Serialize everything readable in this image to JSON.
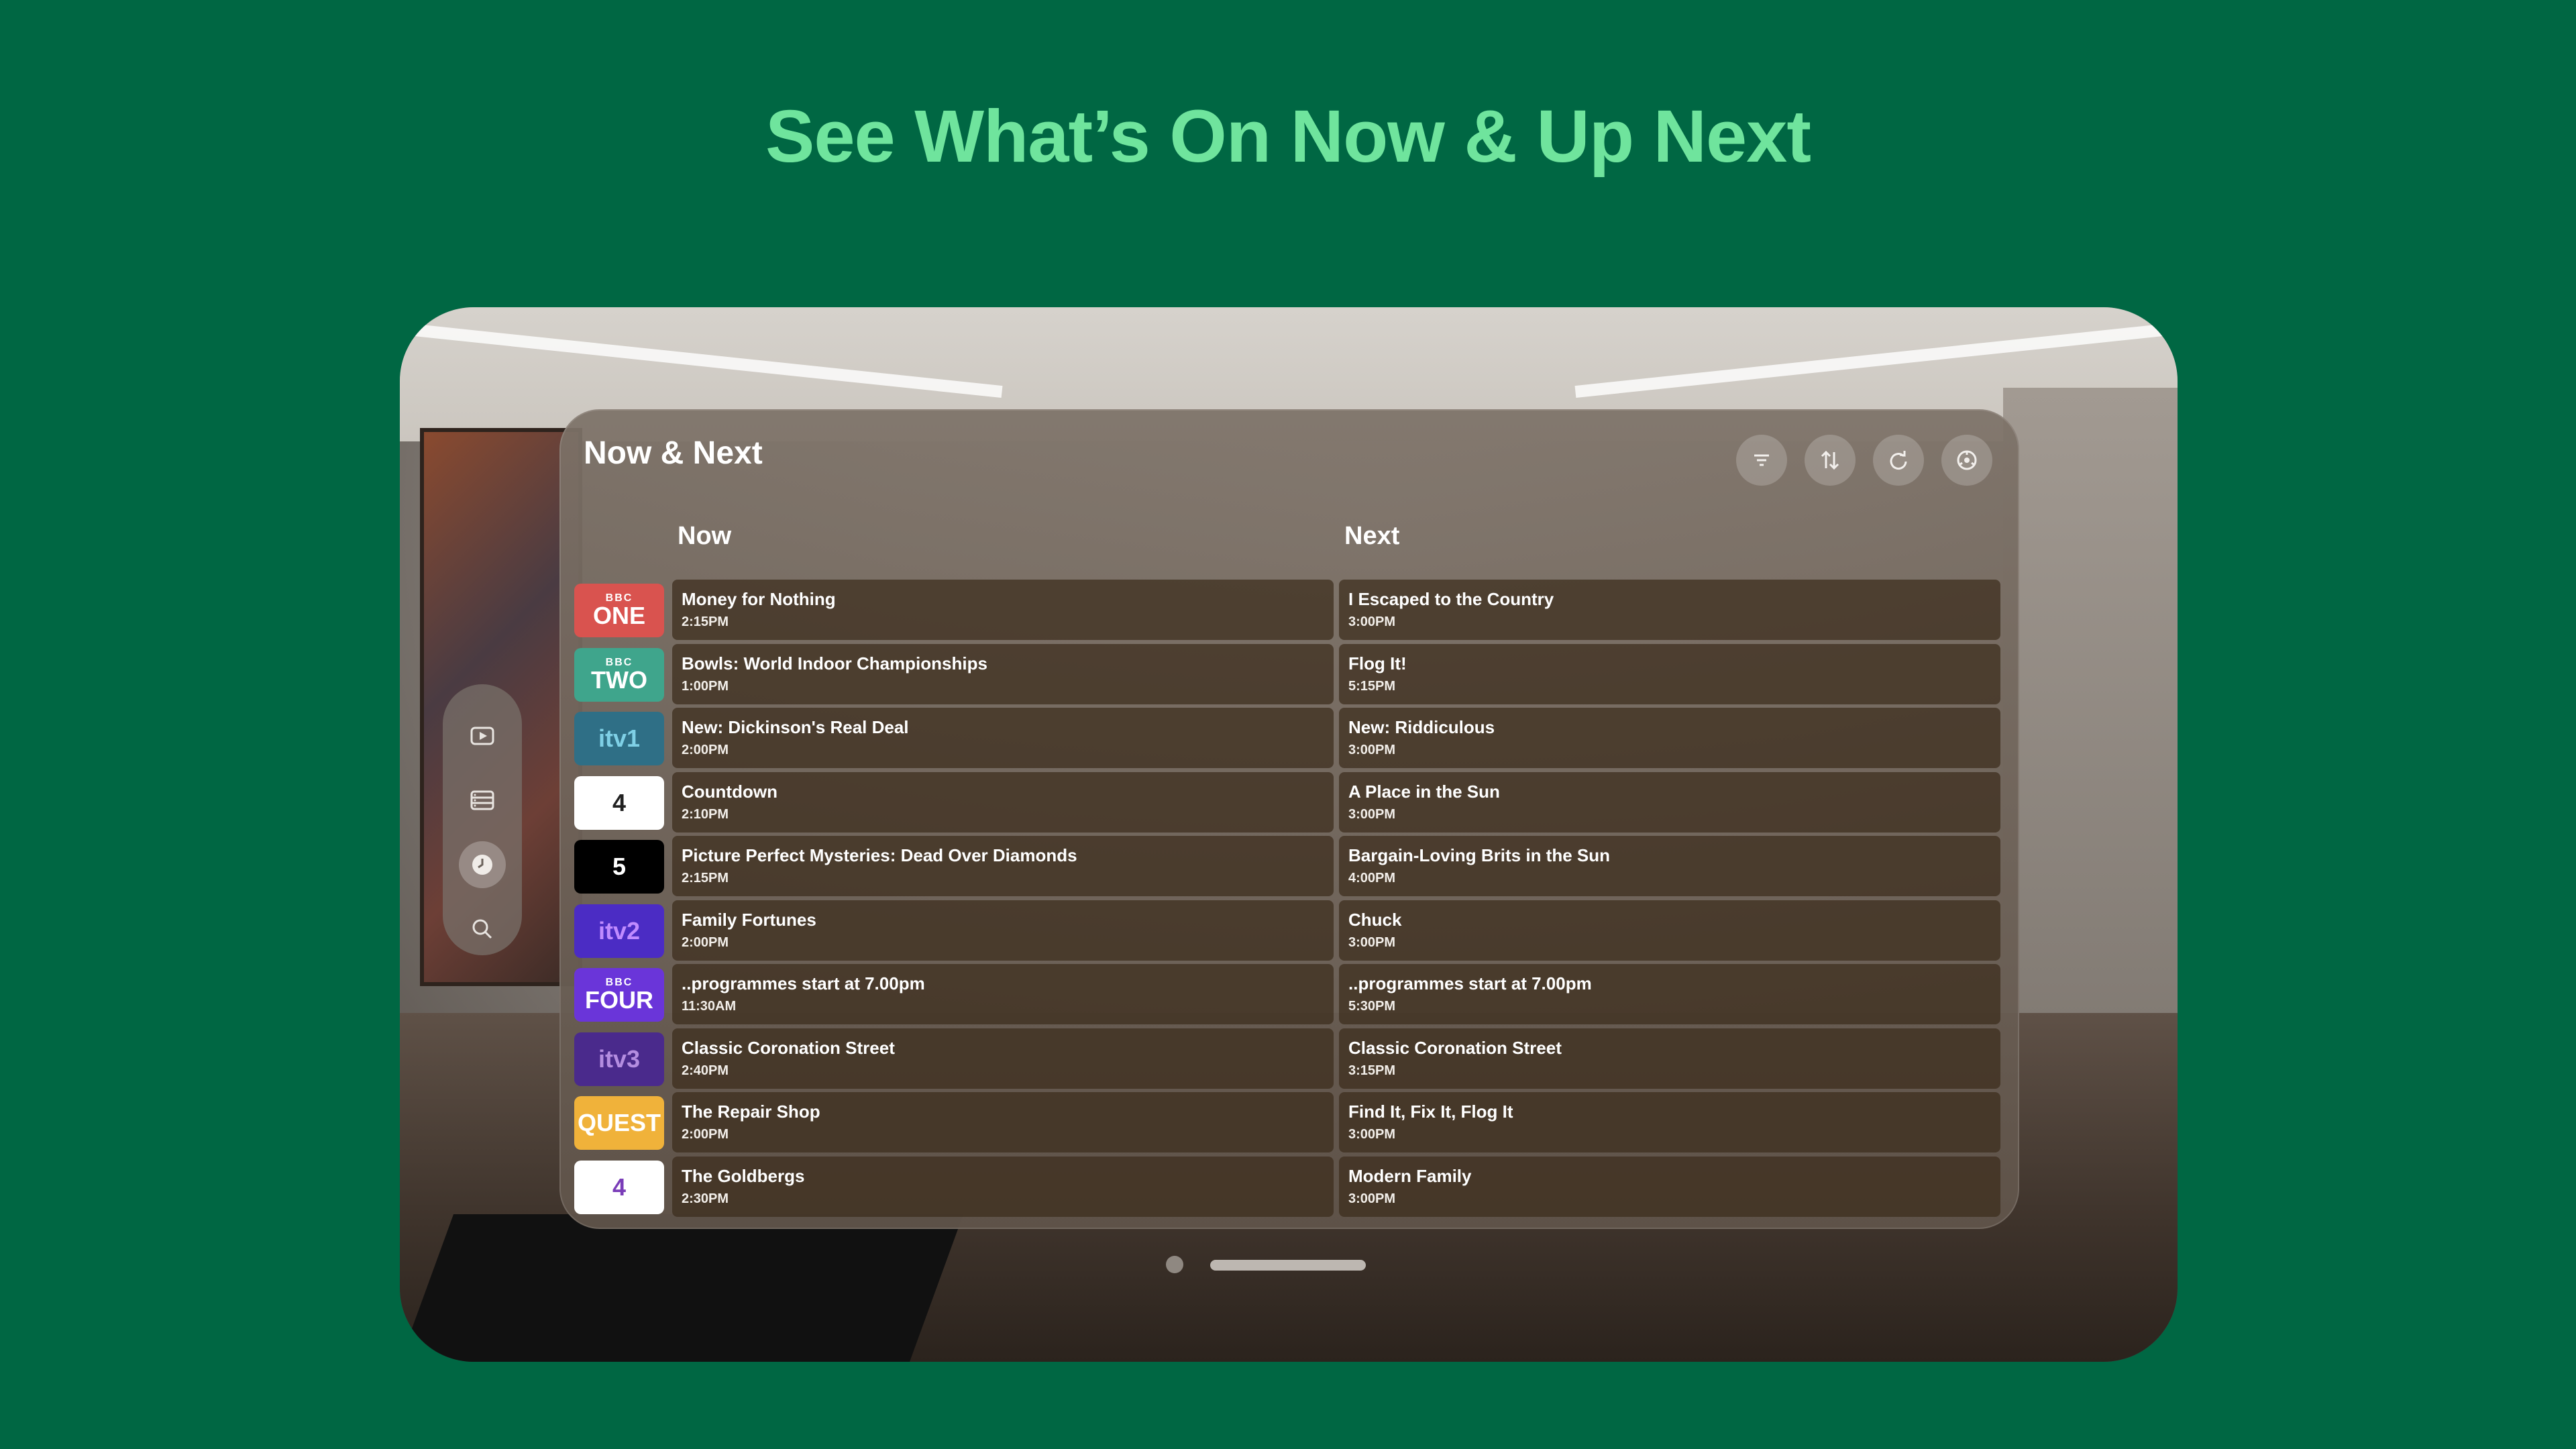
{
  "headline": "See What’s On Now & Up Next",
  "panel": {
    "title": "Now & Next",
    "col_now": "Now",
    "col_next": "Next",
    "toolbar": [
      {
        "name": "filter",
        "icon": "filter-icon"
      },
      {
        "name": "sort",
        "icon": "sort-arrows-icon"
      },
      {
        "name": "refresh",
        "icon": "refresh-icon"
      },
      {
        "name": "settings",
        "icon": "settings-icon"
      }
    ]
  },
  "sidebar": {
    "items": [
      {
        "name": "play",
        "icon": "play-icon",
        "active": false
      },
      {
        "name": "list",
        "icon": "list-icon",
        "active": false
      },
      {
        "name": "clock",
        "icon": "clock-icon",
        "active": true
      },
      {
        "name": "search",
        "icon": "search-icon",
        "active": false
      }
    ]
  },
  "channels": [
    {
      "logo": "ONE",
      "logo_top": "BBC",
      "bg": "#d9534f",
      "fg": "#ffffff",
      "now_title": "Money for Nothing",
      "now_time": "2:15PM",
      "next_title": "I Escaped to the Country",
      "next_time": "3:00PM"
    },
    {
      "logo": "TWO",
      "logo_top": "BBC",
      "bg": "#3fa58c",
      "fg": "#ffffff",
      "now_title": "Bowls: World Indoor Championships",
      "now_time": "1:00PM",
      "next_title": "Flog It!",
      "next_time": "5:15PM"
    },
    {
      "logo": "itv1",
      "logo_top": "",
      "bg": "#2f6f86",
      "fg": "#7fd0e6",
      "now_title": "New: Dickinson's Real Deal",
      "now_time": "2:00PM",
      "next_title": "New: Riddiculous",
      "next_time": "3:00PM"
    },
    {
      "logo": "4",
      "logo_top": "",
      "bg": "#ffffff",
      "fg": "#222222",
      "now_title": "Countdown",
      "now_time": "2:10PM",
      "next_title": "A Place in the Sun",
      "next_time": "3:00PM"
    },
    {
      "logo": "5",
      "logo_top": "",
      "bg": "#000000",
      "fg": "#ffffff",
      "now_title": "Picture Perfect Mysteries: Dead Over Diamonds",
      "now_time": "2:15PM",
      "next_title": "Bargain-Loving Brits in the Sun",
      "next_time": "4:00PM"
    },
    {
      "logo": "itv2",
      "logo_top": "",
      "bg": "#4b2cc4",
      "fg": "#c08bff",
      "now_title": "Family Fortunes",
      "now_time": "2:00PM",
      "next_title": "Chuck",
      "next_time": "3:00PM"
    },
    {
      "logo": "FOUR",
      "logo_top": "BBC",
      "bg": "#6a35d9",
      "fg": "#ffffff",
      "now_title": "..programmes start at 7.00pm",
      "now_time": "11:30AM",
      "next_title": "..programmes start at 7.00pm",
      "next_time": "5:30PM"
    },
    {
      "logo": "itv3",
      "logo_top": "",
      "bg": "#4a2a8c",
      "fg": "#b48de0",
      "now_title": "Classic Coronation Street",
      "now_time": "2:40PM",
      "next_title": "Classic Coronation Street",
      "next_time": "3:15PM"
    },
    {
      "logo": "QUEST",
      "logo_top": "",
      "bg": "#f0b23a",
      "fg": "#ffffff",
      "now_title": "The Repair Shop",
      "now_time": "2:00PM",
      "next_title": "Find It, Fix It, Flog It",
      "next_time": "3:00PM"
    },
    {
      "logo": "4",
      "logo_top": "",
      "bg": "#ffffff",
      "fg": "#7a3db8",
      "now_title": "The Goldbergs",
      "now_time": "2:30PM",
      "next_title": "Modern Family",
      "next_time": "3:00PM"
    }
  ]
}
